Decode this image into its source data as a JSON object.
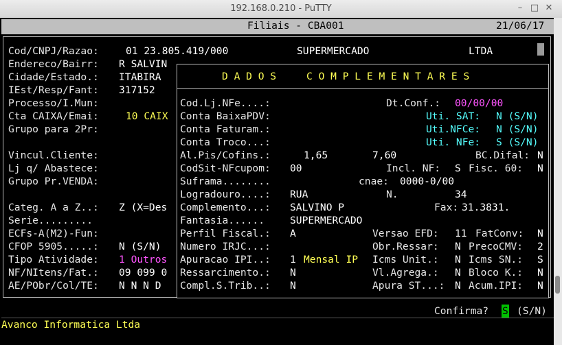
{
  "window": {
    "title": "192.168.0.210 - PuTTY",
    "minimize_glyph": "–",
    "maximize_glyph": "□",
    "close_glyph": "✕"
  },
  "header": {
    "title": "Filiais - CBA001",
    "date": "21/06/17"
  },
  "main_form": {
    "cod_label": "Cod/CNPJ/Razao:",
    "cod_value": "01 23.805.419/000",
    "razao_1": "SUPERMERCADO",
    "razao_2": "LTDA",
    "endereco_label": "Endereco/Bairr:",
    "endereco_value": "R SALVIN",
    "cidade_label": "Cidade/Estado.:",
    "cidade_value": "ITABIRA",
    "iest_label": "IEst/Resp/Fant:",
    "iest_value": "317152",
    "processo_label": "Processo/I.Mun:",
    "cta_label": "Cta CAIXA/Emai:",
    "cta_value": "10 CAIX",
    "grupo2_label": "Grupo para 2Pr:",
    "vincul_label": "Vincul.Cliente:",
    "ljabast_label": "Lj q/ Abastece:",
    "grupopr_label": "Grupo Pr.VENDA:",
    "categ_label": "Categ. A a Z..:",
    "categ_value": "Z (X=Des",
    "serie_label": "Serie.........",
    "ecfs_label": "ECFs-A(M2)-Fun:",
    "cfop_label": "CFOP 5905.....:",
    "cfop_value": "N (S/N)",
    "tipo_label": "Tipo Atividade:",
    "tipo_value": "1 Outros",
    "nf_label": "NF/NItens/Fat.:",
    "nf_value": "09 099 0",
    "ae_label": "AE/PObr/Col/TE:",
    "ae_value": "N N N D"
  },
  "popup": {
    "title": "D A D O S     C O M P L E M E N T A R E S",
    "codlj_label": "Cod.Lj.NFe....:",
    "dtconf_label": "Dt.Conf.:",
    "dtconf_value": "00/00/00",
    "contabaixa_label": "Conta BaixaPDV:",
    "utisat_label": "Uti. SAT:",
    "utisat_value": "N (S/N)",
    "contafat_label": "Conta Faturam.:",
    "utinfce_label": "Uti.NFCe:",
    "utinfce_value": "N (S/N)",
    "contatroco_label": "Conta Troco...:",
    "utinfe_label": "Uti. NFe:",
    "utinfe_value": "S (S/N)",
    "alpis_label": "Al.Pis/Cofins.:",
    "alpis_value": "1,65",
    "alcofins_value": "7,60",
    "bcdifal_label": "BC.Difal:",
    "bcdifal_value": "N",
    "codsit_label": "CodSit-NFcupom:",
    "codsit_value": "00",
    "inclnf_label": "Incl. NF:",
    "inclnf_value": "S",
    "fisc60_label": "Fisc. 60:",
    "fisc60_value": "N",
    "suframa_label": "Suframa........",
    "cnae_label": "cnae:",
    "cnae_value": "0000-0/00",
    "logradouro_label": "Logradouro....:",
    "logradouro_value": "RUA",
    "numero_label": "N.",
    "numero_value": "34",
    "complemento_label": "Complemento...:",
    "complemento_value": "SALVINO P",
    "fax_label": "Fax:",
    "fax_value": "31.3831.",
    "fantasia_label": "Fantasia......",
    "fantasia_value": "SUPERMERCADO",
    "perfil_label": "Perfil Fiscal.:",
    "perfil_value": "A",
    "versaoefd_label": "Versao EFD:",
    "versaoefd_value": "11",
    "fatconv_label": "FatConv:",
    "fatconv_value": "N",
    "numirjc_label": "Numero IRJC...:",
    "obrressar_label": "Obr.Ressar:",
    "obrressar_value": "N",
    "precocmv_label": "PrecoCMV:",
    "precocmv_value": "2",
    "apuracao_label": "Apuracao IPI..:",
    "apuracao_value": "1",
    "apuracao_desc": "Mensal IP",
    "icmsunit_label": "Icms Unit.:",
    "icmsunit_value": "N",
    "icmssn_label": "Icms SN.:",
    "icmssn_value": "S",
    "ressarc_label": "Ressarcimento.:",
    "ressarc_value": "N",
    "vlagrega_label": "Vl.Agrega.:",
    "vlagrega_value": "N",
    "blocok_label": "Bloco K.:",
    "blocok_value": "N",
    "compl_label": "Compl.S.Trib..:",
    "compl_value": "N",
    "apurast_label": "Apura ST...:",
    "apurast_value": "N",
    "acumipi_label": "Acum.IPI:",
    "acumipi_value": "N"
  },
  "prompt": {
    "label": "Confirma?",
    "value": "S",
    "options": "(S/N)"
  },
  "footer": {
    "company": "Avanco Informatica Ltda"
  }
}
